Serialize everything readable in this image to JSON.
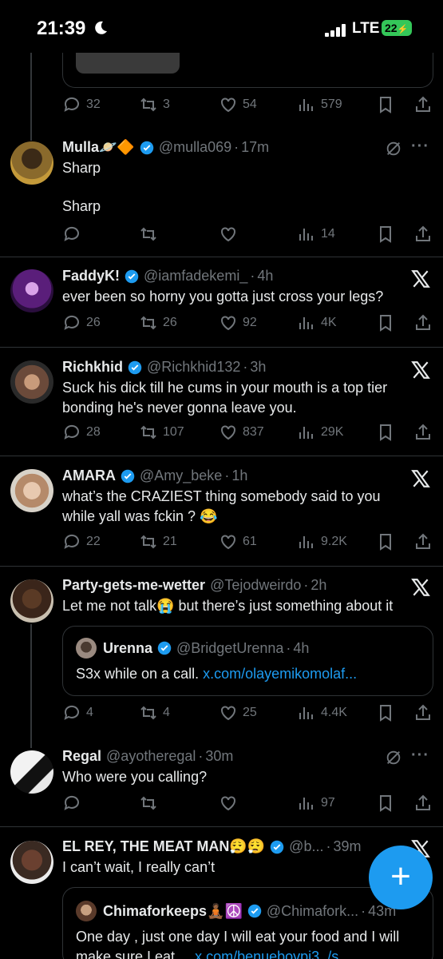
{
  "status_bar": {
    "time": "21:39",
    "network": "LTE",
    "battery": "22"
  },
  "top_tweet": {
    "stats": {
      "replies": "32",
      "retweets": "3",
      "likes": "54",
      "views": "579"
    }
  },
  "tweets": [
    {
      "name": "Mulla🪐🔶",
      "handle": "@mulla069",
      "time": "17m",
      "text_lines": [
        "Sharp",
        "",
        "Sharp"
      ],
      "stats": {
        "replies": "",
        "retweets": "",
        "likes": "",
        "views": "14"
      }
    },
    {
      "name": "FaddyK!",
      "handle": "@iamfadekemi_",
      "time": "4h",
      "text_lines": [
        "ever been so horny you gotta just cross your legs?"
      ],
      "stats": {
        "replies": "26",
        "retweets": "26",
        "likes": "92",
        "views": "4K"
      }
    },
    {
      "name": "Richkhid",
      "handle": "@Richkhid132",
      "time": "3h",
      "text_lines": [
        "Suck his dick till he cums in your mouth is a top tier",
        "bonding he's never gonna leave you."
      ],
      "stats": {
        "replies": "28",
        "retweets": "107",
        "likes": "837",
        "views": "29K"
      }
    },
    {
      "name": "AMARA",
      "handle": "@Amy_beke",
      "time": "1h",
      "text_lines": [
        "what’s the CRAZIEST thing somebody said to you",
        "while yall was fckin ? 😂"
      ],
      "stats": {
        "replies": "22",
        "retweets": "21",
        "likes": "61",
        "views": "9.2K"
      }
    },
    {
      "name": "Party-gets-me-wetter",
      "handle": "@Tejodweirdo",
      "time": "2h",
      "text_lines": [
        "Let me not talk😭 but there’s just something about it"
      ],
      "quote": {
        "name": "Urenna",
        "handle": "@BridgetUrenna",
        "time": "4h",
        "text": "S3x while on a call.",
        "link": "x.com/olayemikomolaf..."
      },
      "stats": {
        "replies": "4",
        "retweets": "4",
        "likes": "25",
        "views": "4.4K"
      }
    },
    {
      "name": "Regal",
      "handle": "@ayotheregal",
      "time": "30m",
      "text_lines": [
        "Who were you calling?"
      ],
      "stats": {
        "replies": "",
        "retweets": "",
        "likes": "",
        "views": "97"
      }
    },
    {
      "name": "EL REY, THE MEAT MAN😮‍💨😮‍💨",
      "handle": "@b...",
      "time": "39m",
      "text_lines": [
        "I can’t wait, I really can’t"
      ],
      "quote": {
        "name": "Chimaforkeeps🧘🏾☮️",
        "handle": "@Chimafork...",
        "time": "43m",
        "text": "One day , just one day I will eat your food and I will",
        "text2": "make sure I eat....",
        "link": "x.com/benuebovpi3_/s..."
      }
    }
  ],
  "fab": {
    "label": "+"
  }
}
